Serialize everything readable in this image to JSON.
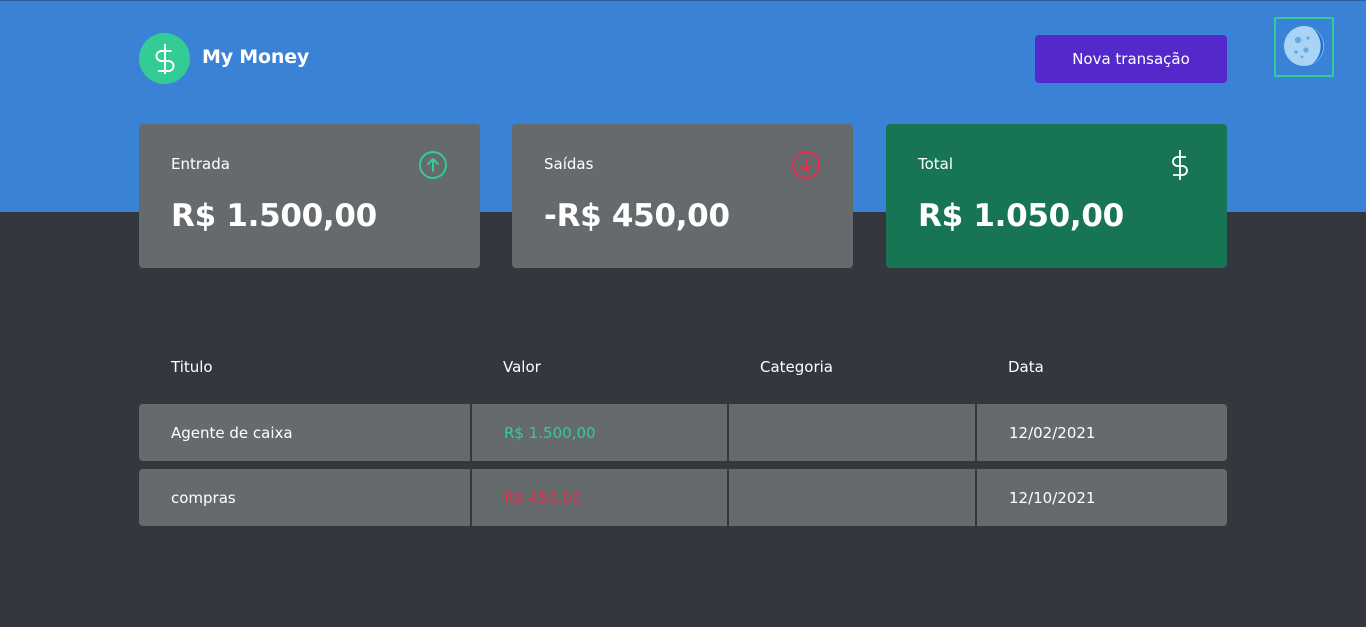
{
  "header": {
    "brand": "My Money",
    "new_transaction_label": "Nova transação",
    "logo_icon": "dollar-icon",
    "theme_toggle_icon": "moon-icon"
  },
  "summary": [
    {
      "label": "Entrada",
      "value": "R$ 1.500,00",
      "icon": "arrow-up-circle-icon",
      "color": "#33cc95"
    },
    {
      "label": "Saídas",
      "value": "-R$ 450,00",
      "icon": "arrow-down-circle-icon",
      "color": "#e52e4d"
    },
    {
      "label": "Total",
      "value": "R$ 1.050,00",
      "icon": "dollar-icon",
      "color": "#187553"
    }
  ],
  "table": {
    "headers": [
      "Titulo",
      "Valor",
      "Categoria",
      "Data"
    ],
    "rows": [
      {
        "title": "Agente de caixa",
        "amount": "R$ 1.500,00",
        "type": "deposit",
        "category": "",
        "date": "12/02/2021"
      },
      {
        "title": "compras",
        "amount": "R$ 450,00",
        "type": "withdraw",
        "category": "",
        "date": "12/10/2021"
      }
    ]
  },
  "colors": {
    "header_bg": "#3a82d6",
    "page_bg": "#34373d",
    "card_bg": "#656a6c",
    "total_bg": "#187553",
    "primary_button": "#5429cc",
    "income": "#33cc95",
    "outcome": "#e52e4d"
  }
}
